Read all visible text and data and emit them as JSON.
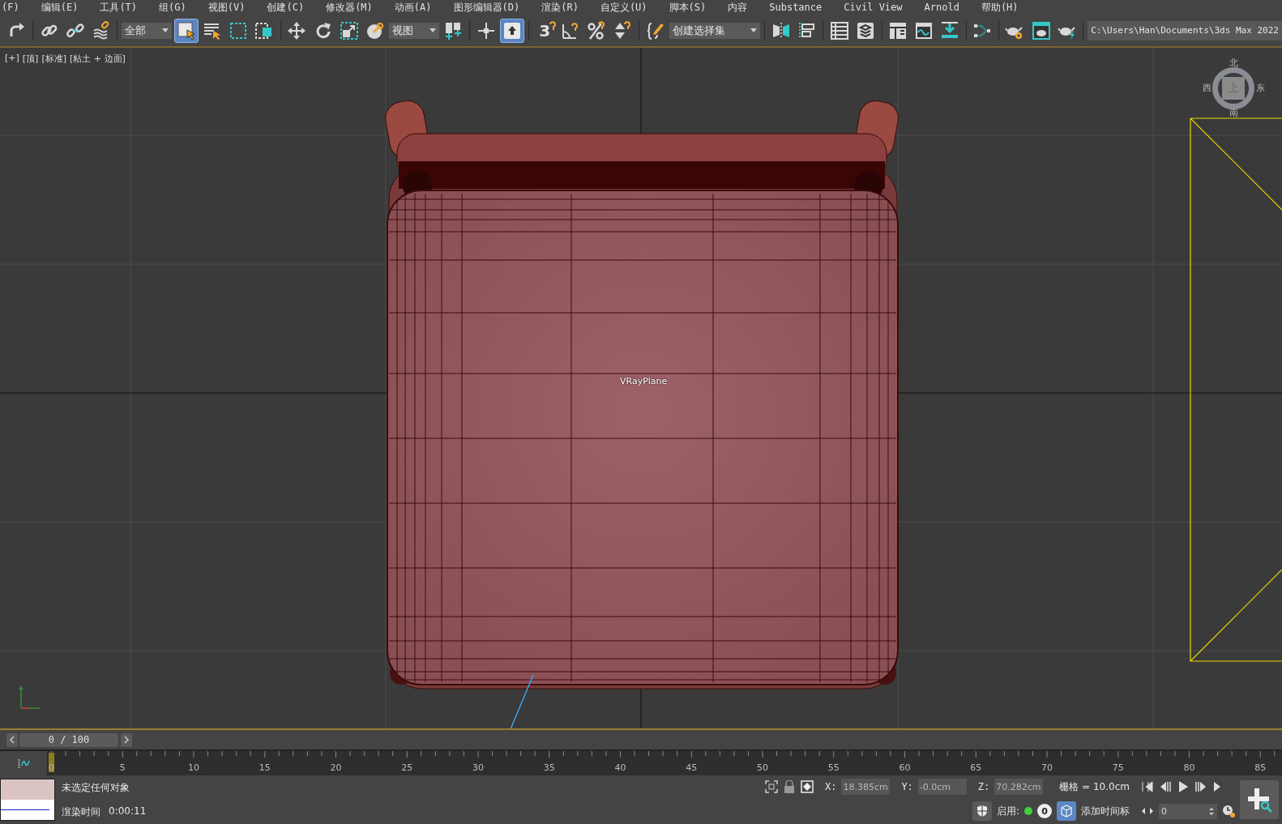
{
  "menu": [
    {
      "label": "(F)"
    },
    {
      "label": "编辑(E)"
    },
    {
      "label": "工具(T)"
    },
    {
      "label": "组(G)"
    },
    {
      "label": "视图(V)"
    },
    {
      "label": "创建(C)"
    },
    {
      "label": "修改器(M)"
    },
    {
      "label": "动画(A)"
    },
    {
      "label": "图形编辑器(D)"
    },
    {
      "label": "渲染(R)"
    },
    {
      "label": "自定义(U)"
    },
    {
      "label": "脚本(S)"
    },
    {
      "label": "内容"
    },
    {
      "label": "Substance"
    },
    {
      "label": "Civil View"
    },
    {
      "label": "Arnold"
    },
    {
      "label": "帮助(H)"
    }
  ],
  "toolbar": [
    {
      "kind": "button",
      "selected": false
    },
    {
      "kind": "separator"
    },
    {
      "kind": "button",
      "selected": false
    },
    {
      "kind": "button",
      "selected": false
    },
    {
      "kind": "button",
      "selected": false
    },
    {
      "kind": "separator"
    },
    {
      "kind": "dropdown",
      "value": "全部"
    },
    {
      "kind": "button",
      "selected": true
    },
    {
      "kind": "button",
      "selected": false
    },
    {
      "kind": "button",
      "selected": false
    },
    {
      "kind": "button",
      "selected": false
    },
    {
      "kind": "separator"
    },
    {
      "kind": "button",
      "selected": false
    },
    {
      "kind": "button",
      "selected": false
    },
    {
      "kind": "button",
      "selected": false
    },
    {
      "kind": "button",
      "selected": false
    },
    {
      "kind": "dropdown",
      "value": "视图"
    },
    {
      "kind": "button",
      "selected": false
    },
    {
      "kind": "separator"
    },
    {
      "kind": "button",
      "selected": false
    },
    {
      "kind": "button",
      "selected": true
    },
    {
      "kind": "separator"
    },
    {
      "kind": "text-button",
      "label": "3",
      "selected": false
    },
    {
      "kind": "button",
      "selected": false
    },
    {
      "kind": "button",
      "selected": false
    },
    {
      "kind": "button",
      "selected": false
    },
    {
      "kind": "separator"
    },
    {
      "kind": "button",
      "selected": false
    },
    {
      "kind": "dropdown",
      "value": "创建选择集"
    },
    {
      "kind": "separator"
    },
    {
      "kind": "button",
      "selected": false
    },
    {
      "kind": "button",
      "selected": false
    },
    {
      "kind": "separator"
    },
    {
      "kind": "button",
      "selected": false
    },
    {
      "kind": "button",
      "selected": false
    },
    {
      "kind": "separator"
    },
    {
      "kind": "button",
      "selected": false
    },
    {
      "kind": "button",
      "selected": false
    },
    {
      "kind": "button",
      "selected": false
    },
    {
      "kind": "separator"
    },
    {
      "kind": "button",
      "selected": false
    },
    {
      "kind": "separator"
    },
    {
      "kind": "button",
      "selected": false
    },
    {
      "kind": "button",
      "selected": false
    },
    {
      "kind": "button",
      "selected": false
    },
    {
      "kind": "separator"
    },
    {
      "kind": "path",
      "value": "C:\\Users\\Han\\Documents\\3ds Max 2022"
    }
  ],
  "viewport": {
    "labels": [
      "[+]",
      "[顶]",
      "[标准]",
      "[粘土 + 边面]"
    ],
    "object_label": "VRayPlane",
    "viewcube": {
      "face": "上",
      "north": "北",
      "west": "西",
      "east": "东",
      "south": "南"
    }
  },
  "timeline": {
    "frame_field": "0 / 100",
    "level": 0,
    "ruler_labels": [
      "0",
      "5",
      "10",
      "15",
      "20",
      "25",
      "30",
      "35",
      "40",
      "45",
      "50",
      "55",
      "60",
      "65",
      "70",
      "75",
      "80",
      "85"
    ]
  },
  "status": {
    "prompt": "未选定任何对象",
    "render_time_label": "渲染时间",
    "render_time": "0:00:11",
    "coords": [
      {
        "axis": "X:",
        "value": "18.385cm"
      },
      {
        "axis": "Y:",
        "value": "-0.0cm"
      },
      {
        "axis": "Z:",
        "value": "70.282cm"
      }
    ],
    "grid": "栅格 = 10.0cm",
    "enable_label": "启用:",
    "enable_on": true,
    "key_count": "0",
    "add_time_tag": "添加时间标",
    "frame": "0"
  }
}
